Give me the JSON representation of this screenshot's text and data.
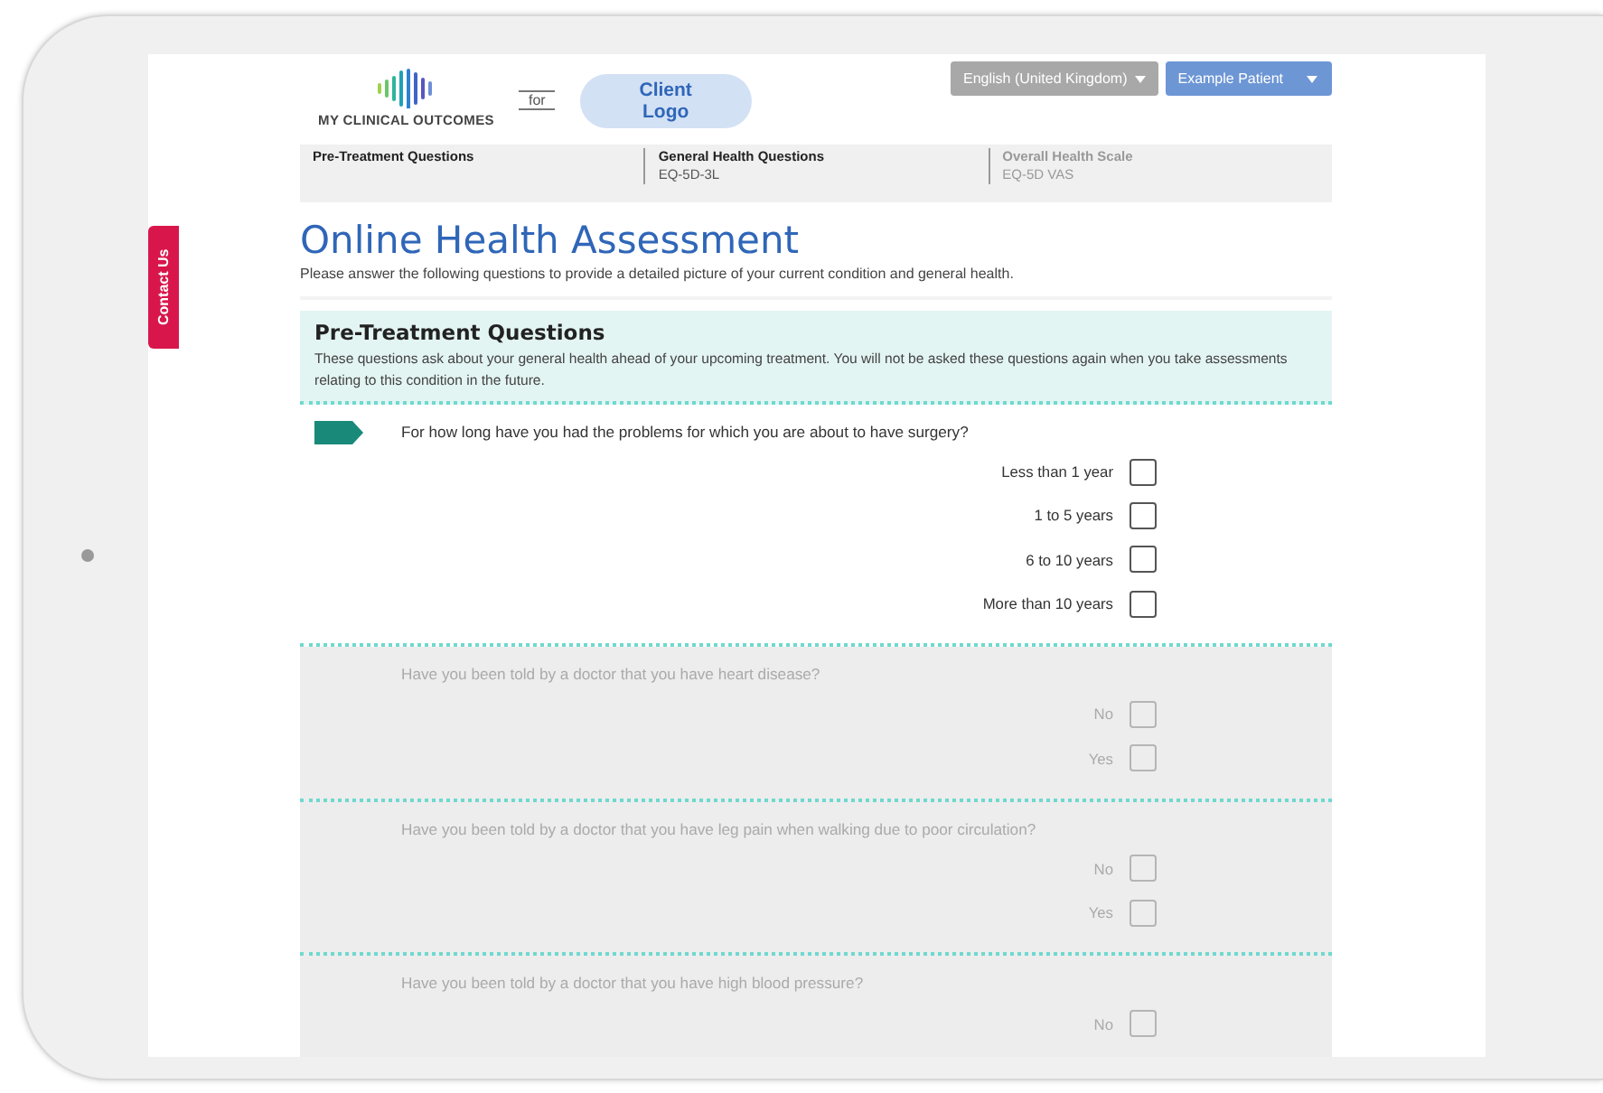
{
  "contact_tab": {
    "label": "Contact Us"
  },
  "header": {
    "logo_text": "MY CLINICAL OUTCOMES",
    "for_label": "for",
    "client_logo": "Client Logo",
    "language_button": "English (United Kingdom)",
    "user_button": "Example Patient"
  },
  "steps": [
    {
      "title": "Pre-Treatment Questions",
      "disabled": false
    },
    {
      "title": "General Health Questions",
      "subtitle": "EQ-5D-3L",
      "disabled": false
    },
    {
      "title": "Overall Health Scale",
      "subtitle": "EQ-5D VAS",
      "disabled": true
    }
  ],
  "page_title": "Online Health Assessment",
  "intro": "Please answer the following questions to provide a detailed picture of your current condition and general health.",
  "section": {
    "title": "Pre-Treatment Questions",
    "description": "These questions ask about your general health ahead of your upcoming treatment. You will not be asked these questions again when you take assessments relating to this condition in the future."
  },
  "questions": [
    {
      "text": "For how long have you had the problems for which you are about to have surgery?",
      "active": true,
      "options": [
        {
          "label": "Less than 1 year",
          "checked": false
        },
        {
          "label": "1 to 5 years",
          "checked": false
        },
        {
          "label": "6 to 10 years",
          "checked": false
        },
        {
          "label": "More than 10 years",
          "checked": false
        }
      ]
    },
    {
      "text": "Have you been told by a doctor that you have heart disease?",
      "active": false,
      "options": [
        {
          "label": "No",
          "checked": false
        },
        {
          "label": "Yes",
          "checked": false
        }
      ]
    },
    {
      "text": "Have you been told by a doctor that you have leg pain when walking due to poor circulation?",
      "active": false,
      "options": [
        {
          "label": "No",
          "checked": false
        },
        {
          "label": "Yes",
          "checked": false
        }
      ]
    },
    {
      "text": "Have you been told by a doctor that you have high blood pressure?",
      "active": false,
      "options": [
        {
          "label": "No",
          "checked": false
        }
      ]
    }
  ]
}
